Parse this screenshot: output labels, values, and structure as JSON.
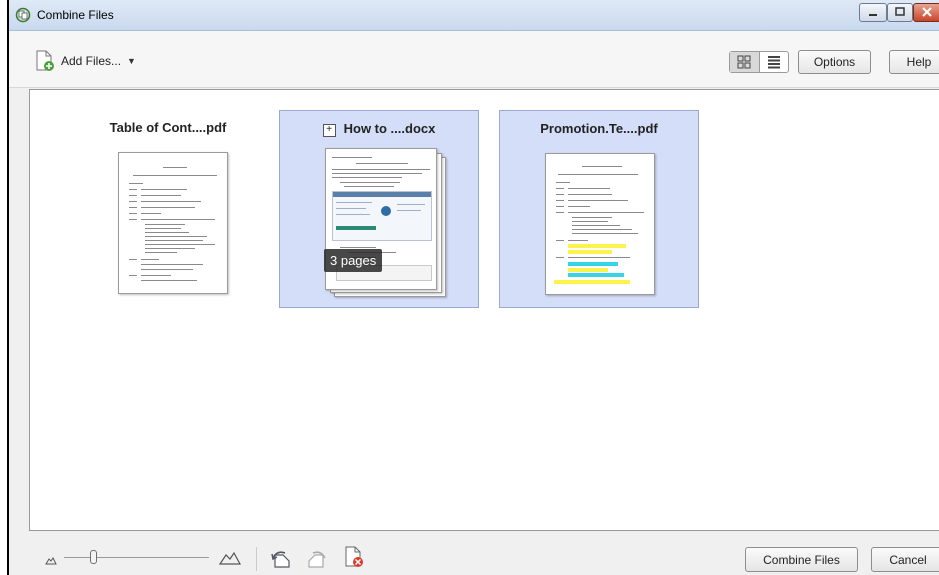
{
  "window": {
    "title": "Combine Files"
  },
  "toolbar": {
    "add_files_label": "Add Files...",
    "options_label": "Options",
    "help_label": "Help",
    "view_mode": "thumbnails"
  },
  "files": [
    {
      "name": "Table of Cont....pdf",
      "selected": false
    },
    {
      "name": "How to ....docx",
      "selected": true,
      "pages_badge": "3 pages"
    },
    {
      "name": "Promotion.Te....pdf",
      "selected": true
    }
  ],
  "footer": {
    "combine_label": "Combine Files",
    "cancel_label": "Cancel"
  },
  "colors": {
    "selection_fill": "#d4def8",
    "highlight_yellow": "#fff24a",
    "highlight_cyan": "#37d3e6"
  }
}
